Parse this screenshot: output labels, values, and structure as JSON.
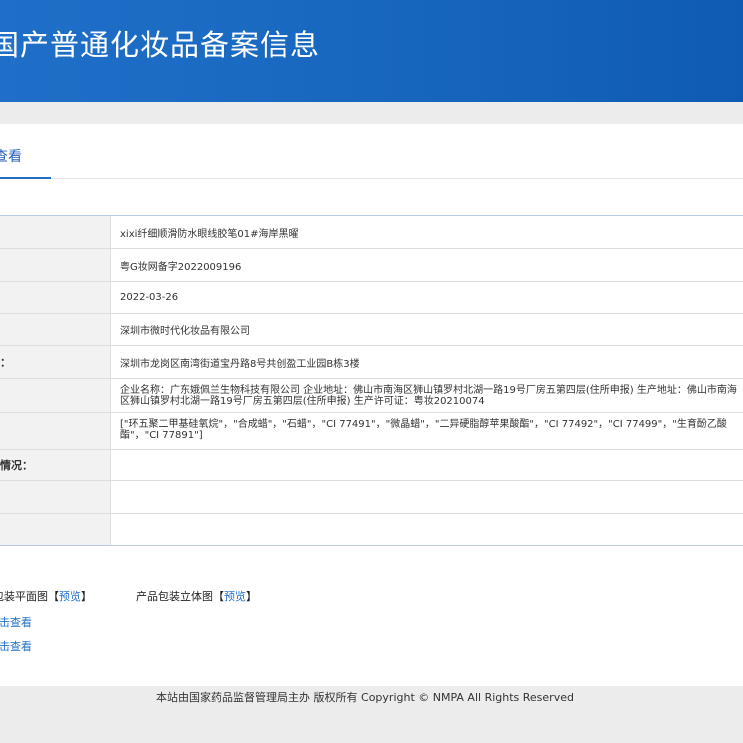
{
  "header": {
    "title": "国产普通化妆品备案信息"
  },
  "tabs": {
    "active_label": "查看"
  },
  "table": {
    "rows": [
      {
        "label": "",
        "value": "xixi纤细顺滑防水眼线胶笔01#海岸黑曜"
      },
      {
        "label": "",
        "value": "粤G妆网备字2022009196"
      },
      {
        "label": "",
        "value": "2022-03-26"
      },
      {
        "label": "",
        "value": "深圳市微时代化妆品有限公司"
      },
      {
        "label": "：",
        "value": "深圳市龙岗区南湾街道宝丹路8号共创盈工业园B栋3楼"
      },
      {
        "label": "",
        "value": "企业名称：广东娥佩兰生物科技有限公司 企业地址：佛山市南海区狮山镇罗村北湖一路19号厂房五第四层(住所申报) 生产地址：佛山市南海区狮山镇罗村北湖一路19号厂房五第四层(住所申报) 生产许可证：粤妆20210074"
      },
      {
        "label": "",
        "value": "[\"环五聚二甲基硅氧烷\"，\"合成蜡\"，\"石蜡\"，\"CI 77491\"，\"微晶蜡\"，\"二异硬脂醇苹果酸酯\"，\"CI 77492\"，\"CI 77499\"，\"生育酚乙酸酯\"，\"CI 77891\"]"
      },
      {
        "label": "情况：",
        "value": ""
      },
      {
        "label": "",
        "value": ""
      },
      {
        "label": "",
        "value": ""
      }
    ]
  },
  "images": {
    "flat_label": "产品包装平面图",
    "solid_label": "产品包装立体图",
    "bracket_open": "【",
    "bracket_close": "】",
    "preview_label": "预览",
    "view_1": "点击查看",
    "view_2": "点击查看"
  },
  "footer": {
    "text": "本站由国家药品监督管理局主办 版权所有 Copyright © NMPA All Rights Reserved"
  }
}
